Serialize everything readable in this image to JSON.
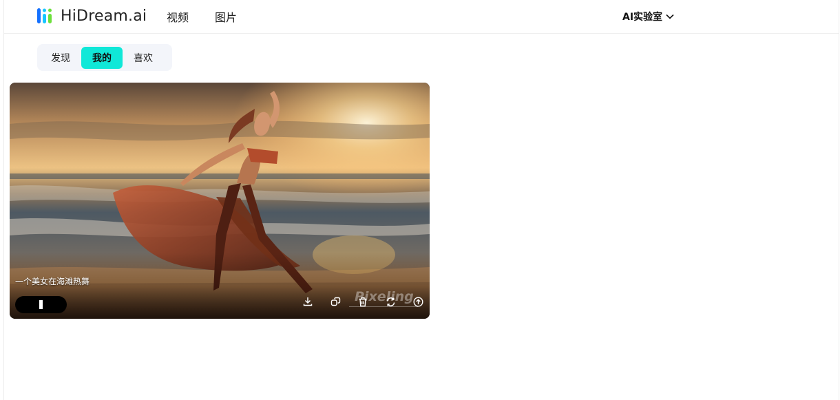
{
  "app": {
    "brand": "HiDream.ai",
    "accent_color": "#10e8d8"
  },
  "nav": {
    "items": [
      {
        "label": "视频",
        "active": true
      },
      {
        "label": "图片",
        "active": false
      }
    ],
    "lab_label": "AI实验室"
  },
  "tabs": {
    "items": [
      {
        "label": "发现",
        "active": false
      },
      {
        "label": "我的",
        "active": true
      },
      {
        "label": "喜欢",
        "active": false
      }
    ]
  },
  "card": {
    "caption": "一个美女在海滩热舞",
    "watermark": "Pixeling",
    "play_icon": "pause-bar-icon",
    "actions": [
      {
        "name": "download-icon"
      },
      {
        "name": "copy-icon"
      },
      {
        "name": "delete-icon"
      },
      {
        "name": "regenerate-icon"
      },
      {
        "name": "upload-icon"
      }
    ]
  }
}
